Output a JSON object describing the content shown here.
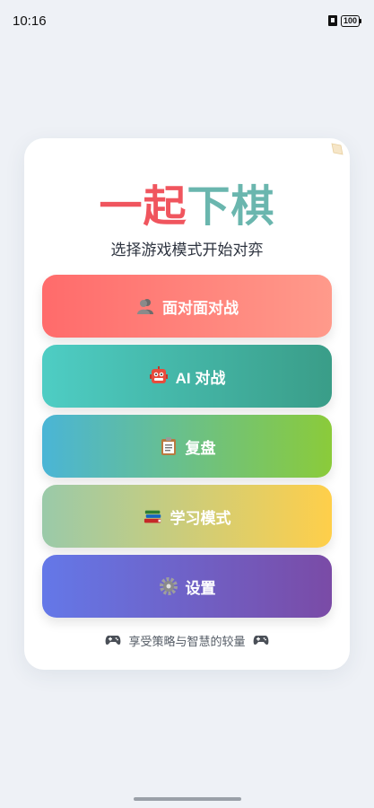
{
  "status": {
    "time": "10:16",
    "battery": "100"
  },
  "app": {
    "title_part1": "一起",
    "title_part2": "下棋",
    "subtitle": "选择游戏模式开始对弈"
  },
  "menu": {
    "items": [
      {
        "label": "面对面对战",
        "icon": "people-silhouette-icon"
      },
      {
        "label": "AI 对战",
        "icon": "robot-icon"
      },
      {
        "label": "复盘",
        "icon": "clipboard-icon"
      },
      {
        "label": "学习模式",
        "icon": "books-icon"
      },
      {
        "label": "设置",
        "icon": "gear-icon"
      }
    ]
  },
  "footer": {
    "text": "享受策略与智慧的较量",
    "icon": "gamepad-icon"
  },
  "colors": {
    "title_red": "#f0555e",
    "title_teal": "#6ab6ae",
    "background": "#eef1f6"
  }
}
